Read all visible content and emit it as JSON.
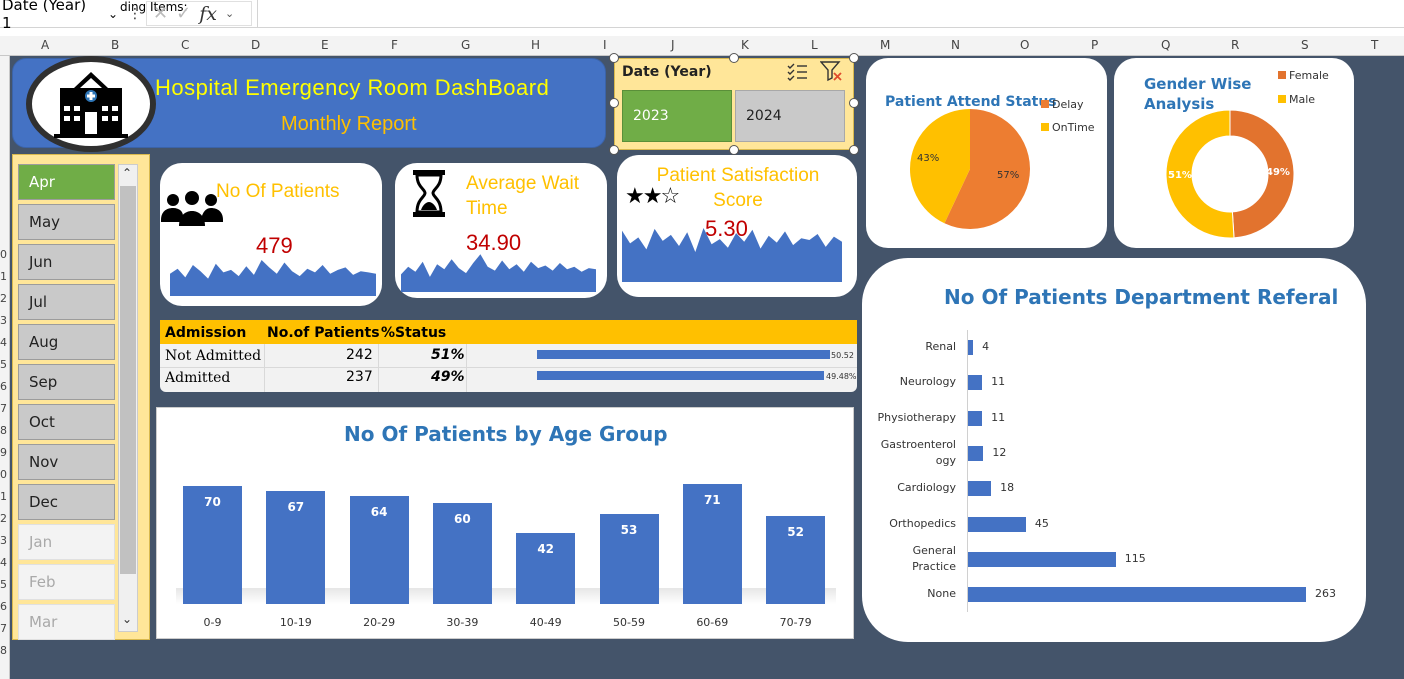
{
  "formula_bar": {
    "name_box": "Date (Year) 1",
    "name_box_chevron": "⌄",
    "formula_fragment": "ding Items:",
    "separator": "⋮",
    "fx": "fx"
  },
  "columns": [
    "A",
    "B",
    "C",
    "D",
    "E",
    "F",
    "G",
    "H",
    "I",
    "J",
    "K",
    "L",
    "M",
    "N",
    "O",
    "P",
    "Q",
    "R",
    "S",
    "T"
  ],
  "rows": [
    "0",
    "1",
    "2",
    "3",
    "4",
    "5",
    "6",
    "7",
    "8",
    "9",
    "0",
    "1",
    "2",
    "3",
    "4",
    "5",
    "6",
    "7",
    "8"
  ],
  "header": {
    "title": "Hospital  Emergency Room DashBoard",
    "subtitle": "Monthly Report"
  },
  "year_slicer": {
    "title": "Date (Year)",
    "items": [
      {
        "label": "2023",
        "state": "selected"
      },
      {
        "label": "2024",
        "state": "available"
      }
    ]
  },
  "month_slicer": {
    "items": [
      {
        "label": "Apr",
        "state": "selected"
      },
      {
        "label": "May",
        "state": "available"
      },
      {
        "label": "Jun",
        "state": "available"
      },
      {
        "label": "Jul",
        "state": "available"
      },
      {
        "label": "Aug",
        "state": "available"
      },
      {
        "label": "Sep",
        "state": "available"
      },
      {
        "label": "Oct",
        "state": "available"
      },
      {
        "label": "Nov",
        "state": "available"
      },
      {
        "label": "Dec",
        "state": "available"
      },
      {
        "label": "Jan",
        "state": "no-data"
      },
      {
        "label": "Feb",
        "state": "no-data"
      },
      {
        "label": "Mar",
        "state": "no-data"
      }
    ]
  },
  "kpis": {
    "patients": {
      "title": "No Of Patients",
      "value": "479"
    },
    "wait_time": {
      "title_line1": "Average Wait",
      "title_line2": "Time",
      "value": "34.90"
    },
    "satisfaction": {
      "title_line1": "Patient Satisfaction",
      "title_line2": "Score",
      "value": "5.30",
      "stars": "★★☆"
    }
  },
  "admission_table": {
    "headers": [
      "Admission",
      "No.of Patients",
      "%Status"
    ],
    "rows": [
      {
        "label": "Not Admitted",
        "count": "242",
        "pct": "51%",
        "bar_fraction": 0.5052,
        "bar_label": "50.52"
      },
      {
        "label": "Admitted",
        "count": "237",
        "pct": "49%",
        "bar_fraction": 0.4948,
        "bar_label": "49.48%"
      }
    ]
  },
  "colors": {
    "accent_blue": "#4472c4",
    "title_blue": "#2e75b6",
    "gold": "#ffc000",
    "orange": "#ed7d31",
    "green": "#70ad47",
    "value_red": "#c00000",
    "dashboard_bg": "#44546a"
  },
  "chart_data": [
    {
      "type": "bar",
      "title": "No Of Patients  by Age Group",
      "categories": [
        "0-9",
        "10-19",
        "20-29",
        "30-39",
        "40-49",
        "50-59",
        "60-69",
        "70-79"
      ],
      "values": [
        70,
        67,
        64,
        60,
        42,
        53,
        71,
        52
      ],
      "ylim": [
        0,
        71
      ]
    },
    {
      "type": "pie",
      "title": "Patient Attend Status",
      "categories": [
        "Delay",
        "OnTime"
      ],
      "values": [
        57,
        43
      ],
      "labels": [
        "57%",
        "43%"
      ],
      "legend": "right"
    },
    {
      "type": "pie",
      "title": "Gender Wise Analysis",
      "categories": [
        "Female",
        "Male"
      ],
      "values": [
        49,
        51
      ],
      "labels": [
        "49%",
        "51%"
      ],
      "legend": "top-right"
    },
    {
      "type": "bar",
      "orientation": "horizontal",
      "title": "No Of Patients Department Referal",
      "categories": [
        "Renal",
        "Neurology",
        "Physiotherapy",
        "Gastroenterology",
        "Cardiology",
        "Orthopedics",
        "General Practice",
        "None"
      ],
      "category_labels": [
        "Renal",
        "Neurology",
        "Physiotherapy",
        "Gastroenterol ogy",
        "Cardiology",
        "Orthopedics",
        "General Practice",
        "None"
      ],
      "values": [
        4,
        11,
        11,
        12,
        18,
        45,
        115,
        263
      ],
      "xlim": [
        0,
        263
      ]
    }
  ],
  "sparklines": {
    "patients": [
      18,
      22,
      15,
      25,
      20,
      14,
      26,
      19,
      21,
      16,
      24,
      17,
      29,
      23,
      18,
      27,
      20,
      16,
      22,
      19,
      25,
      18,
      21,
      23,
      17,
      20,
      19,
      18
    ],
    "wait_time": [
      14,
      20,
      16,
      24,
      12,
      22,
      18,
      26,
      19,
      15,
      23,
      30,
      20,
      17,
      25,
      18,
      22,
      16,
      24,
      19,
      21,
      17,
      23,
      18,
      20,
      16,
      19,
      18
    ],
    "satisfaction": [
      60,
      45,
      52,
      38,
      62,
      48,
      55,
      42,
      58,
      35,
      63,
      44,
      50,
      40,
      57,
      47,
      61,
      39,
      54,
      46,
      59,
      43,
      51,
      49,
      56,
      41,
      53,
      47
    ]
  }
}
